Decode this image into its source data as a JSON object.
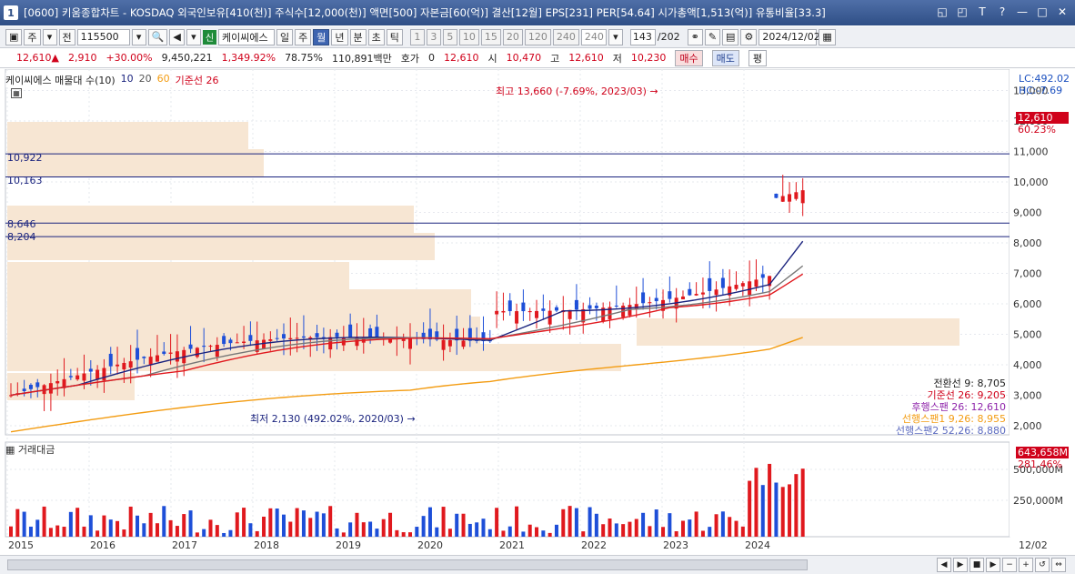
{
  "titlebar": {
    "window_num": "1",
    "title": "[0600] 키움종합차트 - KOSDAQ 외국인보유[410(천)] 주식수[12,000(천)] 액면[500] 자본금[60(억)] 결산[12월] EPS[231] PER[54.64] 시가총액[1,513(억)] 유통비율[33.3]",
    "icons": [
      "restore-icon",
      "dock-icon",
      "font-icon",
      "help-icon",
      "minimize-icon",
      "maximize-icon",
      "close-icon"
    ]
  },
  "toolbar": {
    "market": "주",
    "prev": "전",
    "code": "115500",
    "shin": "신",
    "stock_name": "케이씨에스",
    "periods": [
      "일",
      "주",
      "월",
      "년",
      "분",
      "초",
      "틱"
    ],
    "active_period": "월",
    "intervals": [
      "1",
      "3",
      "5",
      "10",
      "15",
      "20",
      "120",
      "240"
    ],
    "interval_select": "240",
    "count": "143",
    "count_total": "/202",
    "date": "2024/12/02"
  },
  "quote": {
    "price": "12,610",
    "change": "2,910",
    "change_pct": "+30.00%",
    "volume": "9,450,221",
    "volume_pct": "1,349.92%",
    "turnover": "78.75%",
    "amount": "110,891백만",
    "hoga_label": "호가",
    "hoga_value": "0",
    "hoga_price": "12,610",
    "open_label": "시",
    "open": "10,470",
    "high_label": "고",
    "high": "12,610",
    "low_label": "저",
    "low": "10,230",
    "buy_label": "매수",
    "sell_label": "매도",
    "eval_label": "평"
  },
  "legend": {
    "name": "케이씨에스 매물대 수(10)",
    "ma10": "10",
    "ma20": "20",
    "ma60": "60",
    "base": "기준선 26"
  },
  "right_panel": {
    "lc": "LC:492.02",
    "hc": "HC:-7.69",
    "current_price": "12,610",
    "current_pct": "60.23%",
    "vol_current": "643,658M",
    "vol_pct": "281.46%"
  },
  "annotations": {
    "high": "최고 13,660 (-7.69%, 2023/03)",
    "low": "최저 2,130 (492.02%, 2020/03)"
  },
  "hlines": [
    "10,922",
    "10,163",
    "8,646",
    "8,204"
  ],
  "ichimoku": {
    "conversion": "전환선 9: 8,705",
    "base": "기준선 26: 9,205",
    "lagging": "후행스팬 26: 12,610",
    "lead1": "선행스팬1 9,26: 8,955",
    "lead2": "선행스팬2 52,26: 8,880"
  },
  "volume_panel": {
    "title": "거래대금"
  },
  "bottom": {
    "end_date": "12/02"
  },
  "chart_data": {
    "type": "candlestick",
    "title": "",
    "price_ticks": [
      "13,000",
      "12,000",
      "11,000",
      "10,000",
      "9,000",
      "8,000",
      "7,000",
      "6,000",
      "5,000",
      "4,000",
      "3,000",
      "2,000"
    ],
    "volume_ticks": [
      "500,000M",
      "250,000M"
    ],
    "x_labels": [
      "2015",
      "2016",
      "2017",
      "2018",
      "2019",
      "2020",
      "2021",
      "2022",
      "2023",
      "2024"
    ],
    "ylim": [
      1700,
      13700
    ],
    "colors": {
      "up": "#e0191e",
      "down": "#1e4fd8",
      "ma10": "#1a237e",
      "ma20": "#777777",
      "ma60": "#f39c12",
      "base": "#e0191e"
    }
  }
}
